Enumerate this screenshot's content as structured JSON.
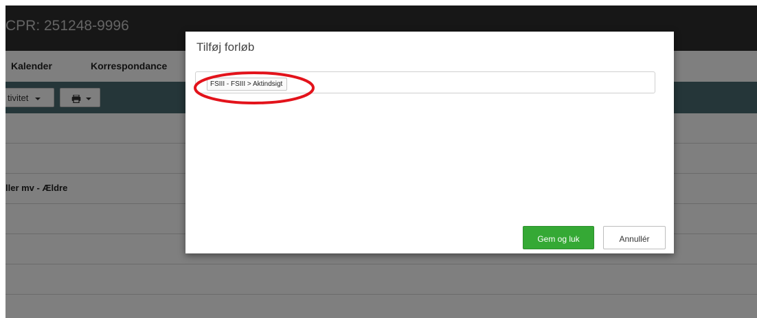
{
  "header": {
    "cpr": "CPR: 251248-9996"
  },
  "tabs": [
    {
      "label": "Kalender"
    },
    {
      "label": "Korrespondance"
    }
  ],
  "toolbar": {
    "activity_label": "tivitet"
  },
  "list": {
    "rows": [
      "ller mv - Ældre"
    ]
  },
  "modal": {
    "title": "Tilføj forløb",
    "selected_chip": "FSIII - FSIII > Aktindsigt",
    "save_label": "Gem og luk",
    "cancel_label": "Annullér"
  },
  "colors": {
    "save_button": "#35a935",
    "highlight_circle": "#e3131b",
    "toolbar": "#4b6c72"
  }
}
